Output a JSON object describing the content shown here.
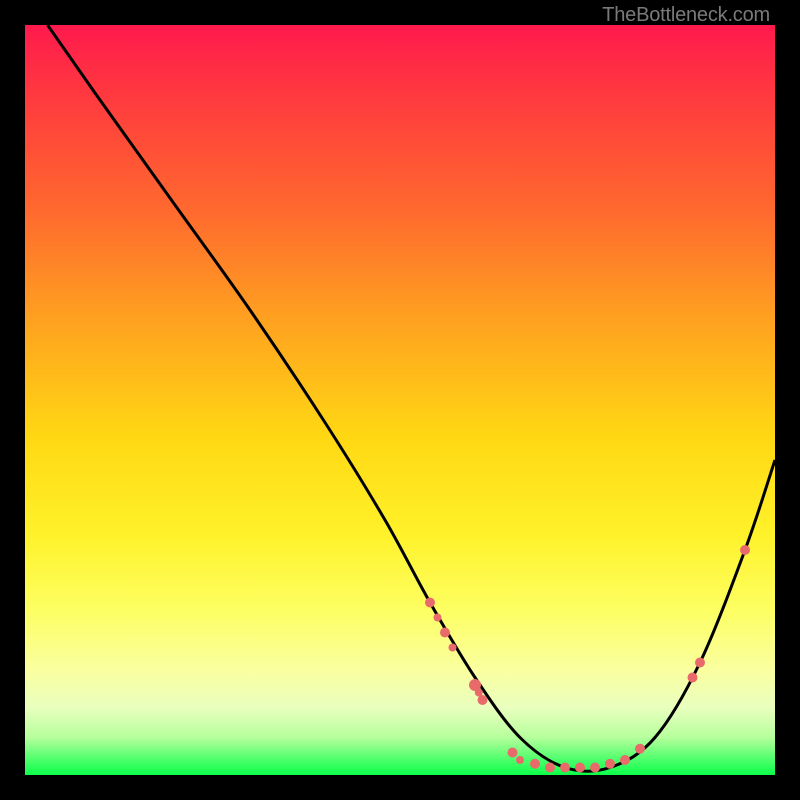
{
  "watermark": "TheBottleneck.com",
  "colors": {
    "curve_stroke": "#000000",
    "marker_fill": "#e96a6a",
    "frame_bg": "#000000"
  },
  "chart_data": {
    "type": "line",
    "title": "",
    "xlabel": "",
    "ylabel": "",
    "xlim": [
      0,
      100
    ],
    "ylim": [
      0,
      100
    ],
    "curve": {
      "name": "bottleneck-curve",
      "x": [
        3,
        10,
        20,
        30,
        40,
        48,
        54,
        60,
        66,
        72,
        78,
        84,
        90,
        96,
        100
      ],
      "y": [
        100,
        90,
        76,
        62,
        47,
        34,
        23,
        13,
        5,
        1,
        1,
        5,
        15,
        30,
        42
      ]
    },
    "markers": {
      "name": "highlight-points",
      "points": [
        {
          "x": 54,
          "y": 23,
          "r": 5
        },
        {
          "x": 55,
          "y": 21,
          "r": 4
        },
        {
          "x": 56,
          "y": 19,
          "r": 5
        },
        {
          "x": 57,
          "y": 17,
          "r": 4
        },
        {
          "x": 60,
          "y": 12,
          "r": 6
        },
        {
          "x": 60.5,
          "y": 11,
          "r": 4
        },
        {
          "x": 61,
          "y": 10,
          "r": 5
        },
        {
          "x": 65,
          "y": 3,
          "r": 5
        },
        {
          "x": 66,
          "y": 2,
          "r": 4
        },
        {
          "x": 68,
          "y": 1.5,
          "r": 5
        },
        {
          "x": 70,
          "y": 1,
          "r": 5
        },
        {
          "x": 72,
          "y": 1,
          "r": 5
        },
        {
          "x": 74,
          "y": 1,
          "r": 5
        },
        {
          "x": 76,
          "y": 1,
          "r": 5
        },
        {
          "x": 78,
          "y": 1.5,
          "r": 5
        },
        {
          "x": 80,
          "y": 2,
          "r": 5
        },
        {
          "x": 82,
          "y": 3.5,
          "r": 5
        },
        {
          "x": 89,
          "y": 13,
          "r": 5
        },
        {
          "x": 90,
          "y": 15,
          "r": 5
        },
        {
          "x": 96,
          "y": 30,
          "r": 5
        }
      ]
    }
  }
}
